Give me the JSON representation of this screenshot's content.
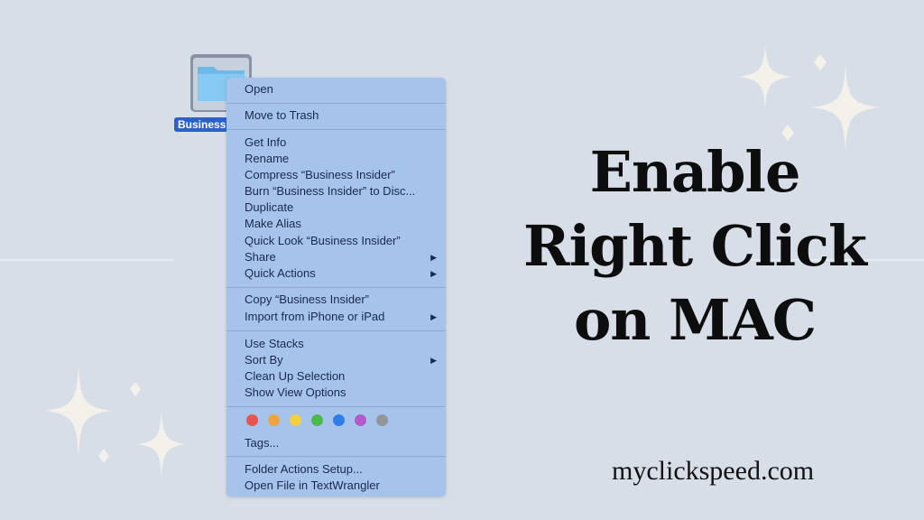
{
  "folder": {
    "label": "Business",
    "icon": "folder-icon"
  },
  "context_menu": {
    "groups": [
      [
        {
          "label": "Open"
        }
      ],
      [
        {
          "label": "Move to Trash"
        }
      ],
      [
        {
          "label": "Get Info"
        },
        {
          "label": "Rename"
        },
        {
          "label": "Compress “Business Insider”"
        },
        {
          "label": "Burn “Business Insider” to Disc..."
        },
        {
          "label": "Duplicate"
        },
        {
          "label": "Make Alias"
        },
        {
          "label": "Quick Look “Business Insider”"
        },
        {
          "label": "Share",
          "submenu": true
        },
        {
          "label": "Quick Actions",
          "submenu": true
        }
      ],
      [
        {
          "label": "Copy “Business Insider”"
        },
        {
          "label": "Import from iPhone or iPad",
          "submenu": true
        }
      ],
      [
        {
          "label": "Use Stacks"
        },
        {
          "label": "Sort By",
          "submenu": true
        },
        {
          "label": "Clean Up Selection"
        },
        {
          "label": "Show View Options"
        }
      ],
      [
        {
          "label": "Tags..."
        }
      ],
      [
        {
          "label": "Folder Actions Setup..."
        },
        {
          "label": "Open File in TextWrangler"
        }
      ]
    ],
    "submenu_arrow": "▶",
    "tag_colors": [
      {
        "name": "red",
        "color": "#e9544e"
      },
      {
        "name": "orange",
        "color": "#f1a43c"
      },
      {
        "name": "yellow",
        "color": "#f4cf3e"
      },
      {
        "name": "green",
        "color": "#4cba4c"
      },
      {
        "name": "blue",
        "color": "#2f7de8"
      },
      {
        "name": "purple",
        "color": "#b25ac9"
      },
      {
        "name": "gray",
        "color": "#939596"
      }
    ]
  },
  "headline": {
    "line1": "Enable",
    "line2": "Right Click",
    "line3": "on MAC"
  },
  "site": "myclickspeed.com",
  "colors": {
    "background": "#d7dee8",
    "menu": "#a6c3ec",
    "sparkle": "#f3f1ea"
  }
}
